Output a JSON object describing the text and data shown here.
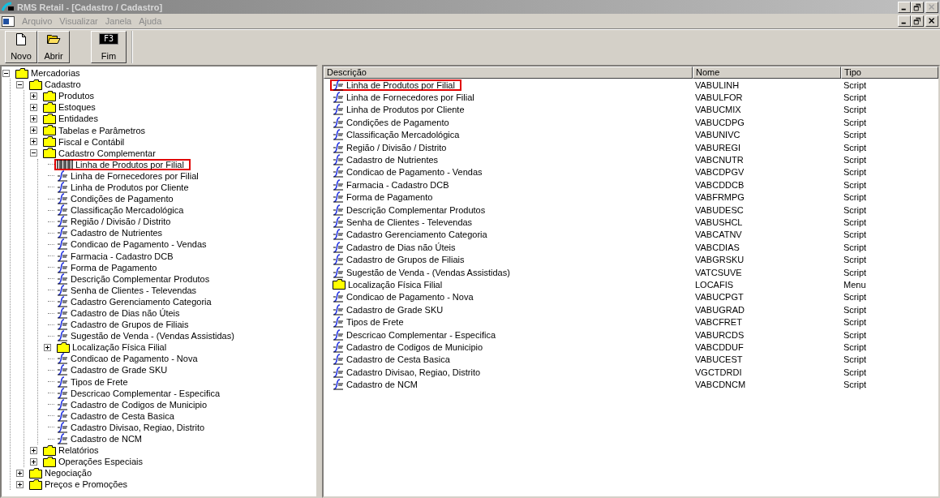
{
  "window": {
    "title": "RMS Retail - [Cadastro / Cadastro]"
  },
  "menu": [
    "Arquivo",
    "Visualizar",
    "Janela",
    "Ajuda"
  ],
  "toolbar": [
    {
      "label": "Novo",
      "kind": "new"
    },
    {
      "label": "Abrir",
      "kind": "open"
    },
    {
      "label": "Fim",
      "kind": "key",
      "key_label": "F3"
    }
  ],
  "tree": [
    {
      "label": "Mercadorias",
      "kind": "folder",
      "expanded": true,
      "highlighted": false,
      "children": [
        {
          "label": "Cadastro",
          "kind": "folder",
          "expanded": true,
          "highlighted": false,
          "children": [
            {
              "label": "Produtos",
              "kind": "folder",
              "expanded": false,
              "highlighted": false
            },
            {
              "label": "Estoques",
              "kind": "folder",
              "expanded": false,
              "highlighted": false
            },
            {
              "label": "Entidades",
              "kind": "folder",
              "expanded": false,
              "highlighted": false
            },
            {
              "label": "Tabelas e Parâmetros",
              "kind": "folder",
              "expanded": false,
              "highlighted": false
            },
            {
              "label": "Fiscal e Contábil",
              "kind": "folder",
              "expanded": false,
              "highlighted": false
            },
            {
              "label": "Cadastro Complementar",
              "kind": "folder",
              "expanded": true,
              "highlighted": false,
              "children": [
                {
                  "label": "Linha de Produtos por Filial",
                  "kind": "opened",
                  "highlighted": true
                },
                {
                  "label": "Linha de Fornecedores por Filial",
                  "kind": "script",
                  "highlighted": false
                },
                {
                  "label": "Linha de Produtos por Cliente",
                  "kind": "script",
                  "highlighted": false
                },
                {
                  "label": "Condições de Pagamento",
                  "kind": "script",
                  "highlighted": false
                },
                {
                  "label": "Classificação Mercadológica",
                  "kind": "script",
                  "highlighted": false
                },
                {
                  "label": "Região / Divisão / Distrito",
                  "kind": "script",
                  "highlighted": false
                },
                {
                  "label": "Cadastro de Nutrientes",
                  "kind": "script",
                  "highlighted": false
                },
                {
                  "label": "Condicao de Pagamento - Vendas",
                  "kind": "script",
                  "highlighted": false
                },
                {
                  "label": "Farmacia - Cadastro DCB",
                  "kind": "script",
                  "highlighted": false
                },
                {
                  "label": "Forma de Pagamento",
                  "kind": "script",
                  "highlighted": false
                },
                {
                  "label": "Descrição Complementar Produtos",
                  "kind": "script",
                  "highlighted": false
                },
                {
                  "label": "Senha de Clientes - Televendas",
                  "kind": "script",
                  "highlighted": false
                },
                {
                  "label": "Cadastro Gerenciamento Categoria",
                  "kind": "script",
                  "highlighted": false
                },
                {
                  "label": "Cadastro de Dias não Úteis",
                  "kind": "script",
                  "highlighted": false
                },
                {
                  "label": "Cadastro de Grupos de Filiais",
                  "kind": "script",
                  "highlighted": false
                },
                {
                  "label": "Sugestão de Venda - (Vendas Assistidas)",
                  "kind": "script",
                  "highlighted": false
                },
                {
                  "label": "Localização Física Filial",
                  "kind": "folder",
                  "expanded": false,
                  "highlighted": false
                },
                {
                  "label": "Condicao de Pagamento - Nova",
                  "kind": "script",
                  "highlighted": false
                },
                {
                  "label": "Cadastro de Grade SKU",
                  "kind": "script",
                  "highlighted": false
                },
                {
                  "label": "Tipos de Frete",
                  "kind": "script",
                  "highlighted": false
                },
                {
                  "label": "Descricao Complementar - Especifica",
                  "kind": "script",
                  "highlighted": false
                },
                {
                  "label": "Cadastro de Codigos de Municipio",
                  "kind": "script",
                  "highlighted": false
                },
                {
                  "label": "Cadastro de Cesta Basica",
                  "kind": "script",
                  "highlighted": false
                },
                {
                  "label": "Cadastro Divisao, Regiao, Distrito",
                  "kind": "script",
                  "highlighted": false
                },
                {
                  "label": "Cadastro de NCM",
                  "kind": "script",
                  "highlighted": false
                }
              ]
            },
            {
              "label": "Relatórios",
              "kind": "folder",
              "expanded": false,
              "highlighted": false
            },
            {
              "label": "Operações Especiais",
              "kind": "folder",
              "expanded": false,
              "highlighted": false
            }
          ]
        },
        {
          "label": "Negociação",
          "kind": "folder",
          "expanded": false,
          "highlighted": false
        },
        {
          "label": "Preços e Promoções",
          "kind": "folder",
          "expanded": false,
          "highlighted": false
        }
      ]
    }
  ],
  "list": {
    "columns": [
      "Descrição",
      "Nome",
      "Tipo"
    ],
    "rows": [
      {
        "description": "Linha de Produtos por Filial",
        "name": "VABULINH",
        "type": "Script",
        "kind": "script",
        "highlighted": true
      },
      {
        "description": "Linha de Fornecedores por Filial",
        "name": "VABULFOR",
        "type": "Script",
        "kind": "script",
        "highlighted": false
      },
      {
        "description": "Linha de Produtos por Cliente",
        "name": "VABUCMIX",
        "type": "Script",
        "kind": "script",
        "highlighted": false
      },
      {
        "description": "Condições de Pagamento",
        "name": "VABUCDPG",
        "type": "Script",
        "kind": "script",
        "highlighted": false
      },
      {
        "description": "Classificação Mercadológica",
        "name": "VABUNIVC",
        "type": "Script",
        "kind": "script",
        "highlighted": false
      },
      {
        "description": "Região / Divisão / Distrito",
        "name": "VABUREGI",
        "type": "Script",
        "kind": "script",
        "highlighted": false
      },
      {
        "description": "Cadastro de Nutrientes",
        "name": "VABCNUTR",
        "type": "Script",
        "kind": "script",
        "highlighted": false
      },
      {
        "description": "Condicao de Pagamento - Vendas",
        "name": "VABCDPGV",
        "type": "Script",
        "kind": "script",
        "highlighted": false
      },
      {
        "description": "Farmacia - Cadastro DCB",
        "name": "VABCDDCB",
        "type": "Script",
        "kind": "script",
        "highlighted": false
      },
      {
        "description": "Forma de Pagamento",
        "name": "VABFRMPG",
        "type": "Script",
        "kind": "script",
        "highlighted": false
      },
      {
        "description": "Descrição Complementar Produtos",
        "name": "VABUDESC",
        "type": "Script",
        "kind": "script",
        "highlighted": false
      },
      {
        "description": "Senha de Clientes - Televendas",
        "name": "VABUSHCL",
        "type": "Script",
        "kind": "script",
        "highlighted": false
      },
      {
        "description": "Cadastro Gerenciamento Categoria",
        "name": "VABCATNV",
        "type": "Script",
        "kind": "script",
        "highlighted": false
      },
      {
        "description": "Cadastro de Dias não Úteis",
        "name": "VABCDIAS",
        "type": "Script",
        "kind": "script",
        "highlighted": false
      },
      {
        "description": "Cadastro de Grupos de Filiais",
        "name": "VABGRSKU",
        "type": "Script",
        "kind": "script",
        "highlighted": false
      },
      {
        "description": "Sugestão de Venda - (Vendas Assistidas)",
        "name": "VATCSUVE",
        "type": "Script",
        "kind": "script",
        "highlighted": false
      },
      {
        "description": "Localização Física Filial",
        "name": "LOCAFIS",
        "type": "Menu",
        "kind": "folder",
        "highlighted": false
      },
      {
        "description": "Condicao de Pagamento - Nova",
        "name": "VABUCPGT",
        "type": "Script",
        "kind": "script",
        "highlighted": false
      },
      {
        "description": "Cadastro de Grade SKU",
        "name": "VABUGRAD",
        "type": "Script",
        "kind": "script",
        "highlighted": false
      },
      {
        "description": "Tipos de Frete",
        "name": "VABCFRET",
        "type": "Script",
        "kind": "script",
        "highlighted": false
      },
      {
        "description": "Descricao Complementar - Especifica",
        "name": "VABURCDS",
        "type": "Script",
        "kind": "script",
        "highlighted": false
      },
      {
        "description": "Cadastro de Codigos de Municipio",
        "name": "VABCDDUF",
        "type": "Script",
        "kind": "script",
        "highlighted": false
      },
      {
        "description": "Cadastro de Cesta Basica",
        "name": "VABUCEST",
        "type": "Script",
        "kind": "script",
        "highlighted": false
      },
      {
        "description": "Cadastro Divisao, Regiao, Distrito",
        "name": "VGCTDRDI",
        "type": "Script",
        "kind": "script",
        "highlighted": false
      },
      {
        "description": "Cadastro de NCM",
        "name": "VABCDNCM",
        "type": "Script",
        "kind": "script",
        "highlighted": false
      }
    ]
  }
}
